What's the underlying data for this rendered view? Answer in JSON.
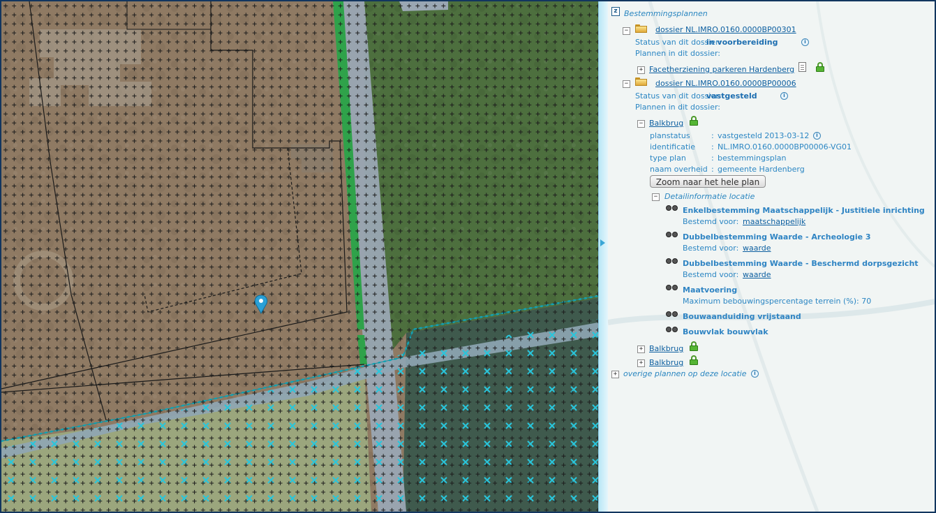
{
  "colors": {
    "accent": "#2f84c3",
    "link": "#0d5fa0",
    "frame": "#12365f",
    "lock": "#55b534"
  },
  "map": {
    "marker_icon": "map-pin-icon",
    "overlay_desc": "aerial photo with bestemmingsplan overlay",
    "hatch_symbol": "+",
    "archeo_symbol": "×"
  },
  "tree": {
    "root_icon": "zoom-icon",
    "root_label": "Bestemmingsplannen",
    "dossiers": [
      {
        "link": "dossier NL.IMRO.0160.0000BP00301",
        "status_label": "Status van dit dossier:",
        "status_value": "in voorbereiding",
        "plans_label": "Plannen in dit dossier:",
        "plans": [
          {
            "name": "Facetherziening parkeren Hardenberg"
          }
        ]
      },
      {
        "link": "dossier NL.IMRO.0160.0000BP00006",
        "status_label": "Status van dit dossier:",
        "status_value": "vastgesteld",
        "plans_label": "Plannen in dit dossier:",
        "plans": [
          {
            "name": "Balkbrug",
            "details": [
              {
                "key": "planstatus",
                "sep": ":",
                "value": "vastgesteld 2013-03-12"
              },
              {
                "key": "identificatie",
                "sep": ":",
                "value": "NL.IMRO.0160.0000BP00006-VG01"
              },
              {
                "key": "type plan",
                "sep": ":",
                "value": "bestemmingsplan"
              },
              {
                "key": "naam overheid",
                "sep": ":",
                "value": "gemeente Hardenberg"
              }
            ],
            "zoom_button": "Zoom naar het hele plan",
            "detail_header": "Detailinformatie locatie",
            "locations": [
              {
                "title": "Enkelbestemming Maatschappelijk - Justitiele inrichting",
                "sub_label": "Bestemd voor:",
                "sub_link": "maatschappelijk"
              },
              {
                "title": "Dubbelbestemming Waarde - Archeologie 3",
                "sub_label": "Bestemd voor:",
                "sub_link": "waarde"
              },
              {
                "title": "Dubbelbestemming Waarde - Beschermd dorpsgezicht",
                "sub_label": "Bestemd voor:",
                "sub_link": "waarde"
              },
              {
                "title": "Maatvoering",
                "sub_label": "Maximum bebouwingspercentage terrein (%): 70",
                "sub_link": ""
              },
              {
                "title": "Bouwaanduiding vrijstaand",
                "sub_label": "",
                "sub_link": ""
              },
              {
                "title": "Bouwvlak bouwvlak",
                "sub_label": "",
                "sub_link": ""
              }
            ]
          },
          {
            "name": "Balkbrug"
          },
          {
            "name": "Balkbrug"
          }
        ]
      }
    ],
    "other_plans": "overige plannen op deze locatie"
  }
}
